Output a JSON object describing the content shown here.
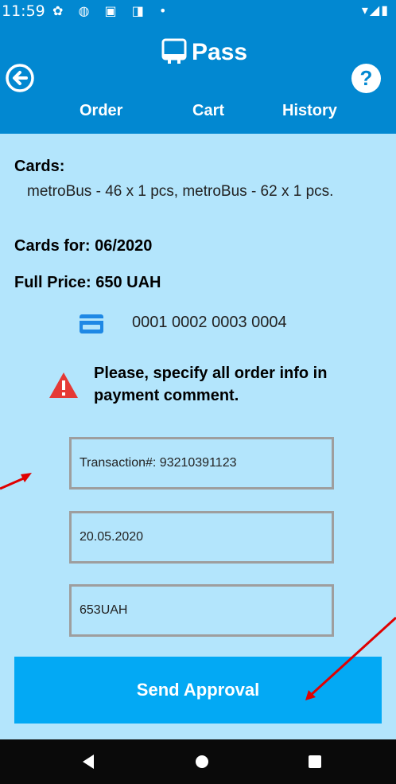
{
  "status_bar": {
    "time": "11:59",
    "left_icons": [
      "gear-icon",
      "shield-icon",
      "a-icon",
      "sd-card-icon",
      "dot-icon"
    ],
    "left_glyphs": "✿ ◍ ▣ ◨ •",
    "right_glyphs": "▾◢▮"
  },
  "header": {
    "title": "Pass",
    "title_icon": "bus-icon",
    "back_icon": "back-arrow-icon",
    "help_label": "?",
    "tabs": [
      {
        "label": "Order"
      },
      {
        "label": "Cart"
      },
      {
        "label": "History"
      }
    ]
  },
  "order": {
    "cards_label": "Cards:",
    "cards_text": "metroBus - 46 x 1 pcs,  metroBus - 62 x 1 pcs.",
    "cards_for": "Cards for: 06/2020",
    "full_price": "Full Price: 650 UAH",
    "card_number": "0001 0002 0003 0004",
    "card_icon": "credit-card-icon",
    "warning_icon": "warning-icon",
    "warning_text": "Please, specify all order info in payment comment."
  },
  "form": {
    "transaction_value": "Transaction#: 93210391123",
    "date_value": "20.05.2020",
    "amount_value": "653UAH",
    "submit_label": "Send Approval"
  },
  "colors": {
    "primary": "#0288D1",
    "background": "#B3E5FC",
    "button": "#03A9F4",
    "warning": "#E53935",
    "annotation_arrow": "#E00000"
  },
  "nav_bar": {
    "icons": [
      "back-triangle-icon",
      "home-circle-icon",
      "recents-square-icon"
    ]
  }
}
